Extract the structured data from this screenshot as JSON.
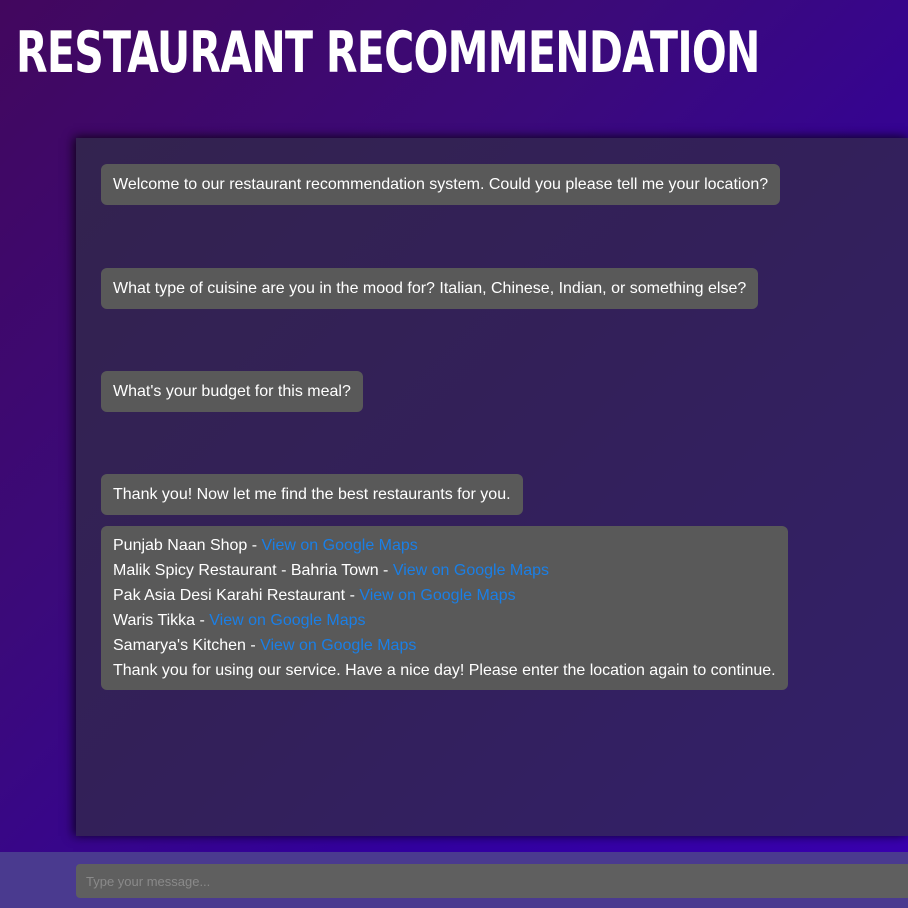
{
  "header": {
    "title": "RESTAURANT RECOMMENDATION"
  },
  "chat": {
    "messages": [
      "Welcome to our restaurant recommendation system. Could you please tell me your location?",
      "What type of cuisine are you in the mood for? Italian, Chinese, Indian, or something else?",
      "What's your budget for this meal?",
      "Thank you! Now let me find the best restaurants for you."
    ],
    "results": [
      {
        "name": "Punjab Naan Shop",
        "separator": " - ",
        "link_label": "View on Google Maps"
      },
      {
        "name": "Malik Spicy Restaurant - Bahria Town",
        "separator": " - ",
        "link_label": "View on Google Maps"
      },
      {
        "name": "Pak Asia Desi Karahi Restaurant",
        "separator": " - ",
        "link_label": "View on Google Maps"
      },
      {
        "name": "Waris Tikka",
        "separator": " - ",
        "link_label": "View on Google Maps"
      },
      {
        "name": "Samarya's Kitchen",
        "separator": " - ",
        "link_label": "View on Google Maps"
      }
    ],
    "closing": "Thank you for using our service. Have a nice day! Please enter the location again to continue."
  },
  "input": {
    "placeholder": "Type your message...",
    "value": ""
  },
  "colors": {
    "link": "#1a7fe6",
    "bubble": "#595959",
    "panel": "#33234f"
  }
}
